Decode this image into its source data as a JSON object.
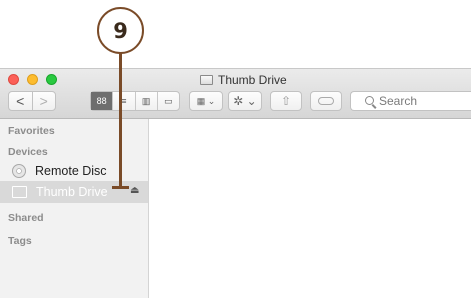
{
  "callout": {
    "number": "9"
  },
  "window": {
    "title": "Thumb Drive"
  },
  "toolbar": {
    "back": "<",
    "forward": ">",
    "view_icon": "88",
    "arrange_icon": "▦ ⌄",
    "action_icon": "✲ ⌄",
    "share_icon": "⇧",
    "search_placeholder": "Search"
  },
  "sidebar": {
    "favorites_heading": "Favorites",
    "devices_heading": "Devices",
    "remote_disc": "Remote Disc",
    "thumb_drive": "Thumb Drive",
    "eject": "⏏",
    "shared_heading": "Shared",
    "tags_heading": "Tags"
  }
}
